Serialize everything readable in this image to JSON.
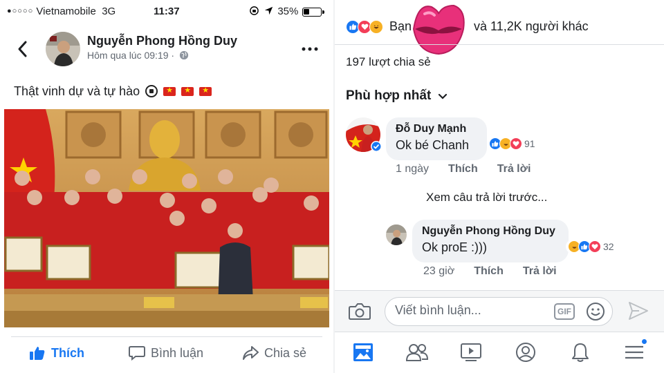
{
  "status_bar": {
    "signal_dots": "●○○○○",
    "carrier": "Vietnamobile",
    "network": "3G",
    "time": "11:37",
    "battery": "35%",
    "battery_level": 0.35
  },
  "post": {
    "author": "Nguyễn Phong Hồng Duy",
    "meta": "Hôm qua lúc 09:19 ·",
    "caption": "Thật vinh dự và tự hào",
    "actions": {
      "like": "Thích",
      "comment": "Bình luận",
      "share": "Chia sẻ"
    }
  },
  "engagement": {
    "reactions_prefix": "Bạn",
    "reactions_suffix": "và 11,2K người khác",
    "shares": "197 lượt chia sẻ",
    "sort_label": "Phù hợp nhất"
  },
  "comments": [
    {
      "author": "Đỗ Duy Mạnh",
      "text": "Ok bé Chanh",
      "reaction_count": "91",
      "time": "1 ngày",
      "like": "Thích",
      "reply": "Trả lời"
    }
  ],
  "view_previous": "Xem câu trả lời trước...",
  "reply": {
    "author": "Nguyễn Phong Hồng Duy",
    "text": "Ok proE :)))",
    "reaction_count": "32",
    "time": "23 giờ",
    "like": "Thích",
    "reply": "Trả lời"
  },
  "composer": {
    "placeholder": "Viết bình luận...",
    "gif_label": "GIF"
  },
  "colors": {
    "accent": "#1877f2",
    "love": "#f33e58",
    "haha": "#f7b125",
    "lips": "#e8307a"
  },
  "icons": {
    "nav": [
      "news-feed-icon",
      "friends-icon",
      "watch-icon",
      "profile-icon",
      "notifications-icon",
      "menu-icon"
    ]
  }
}
